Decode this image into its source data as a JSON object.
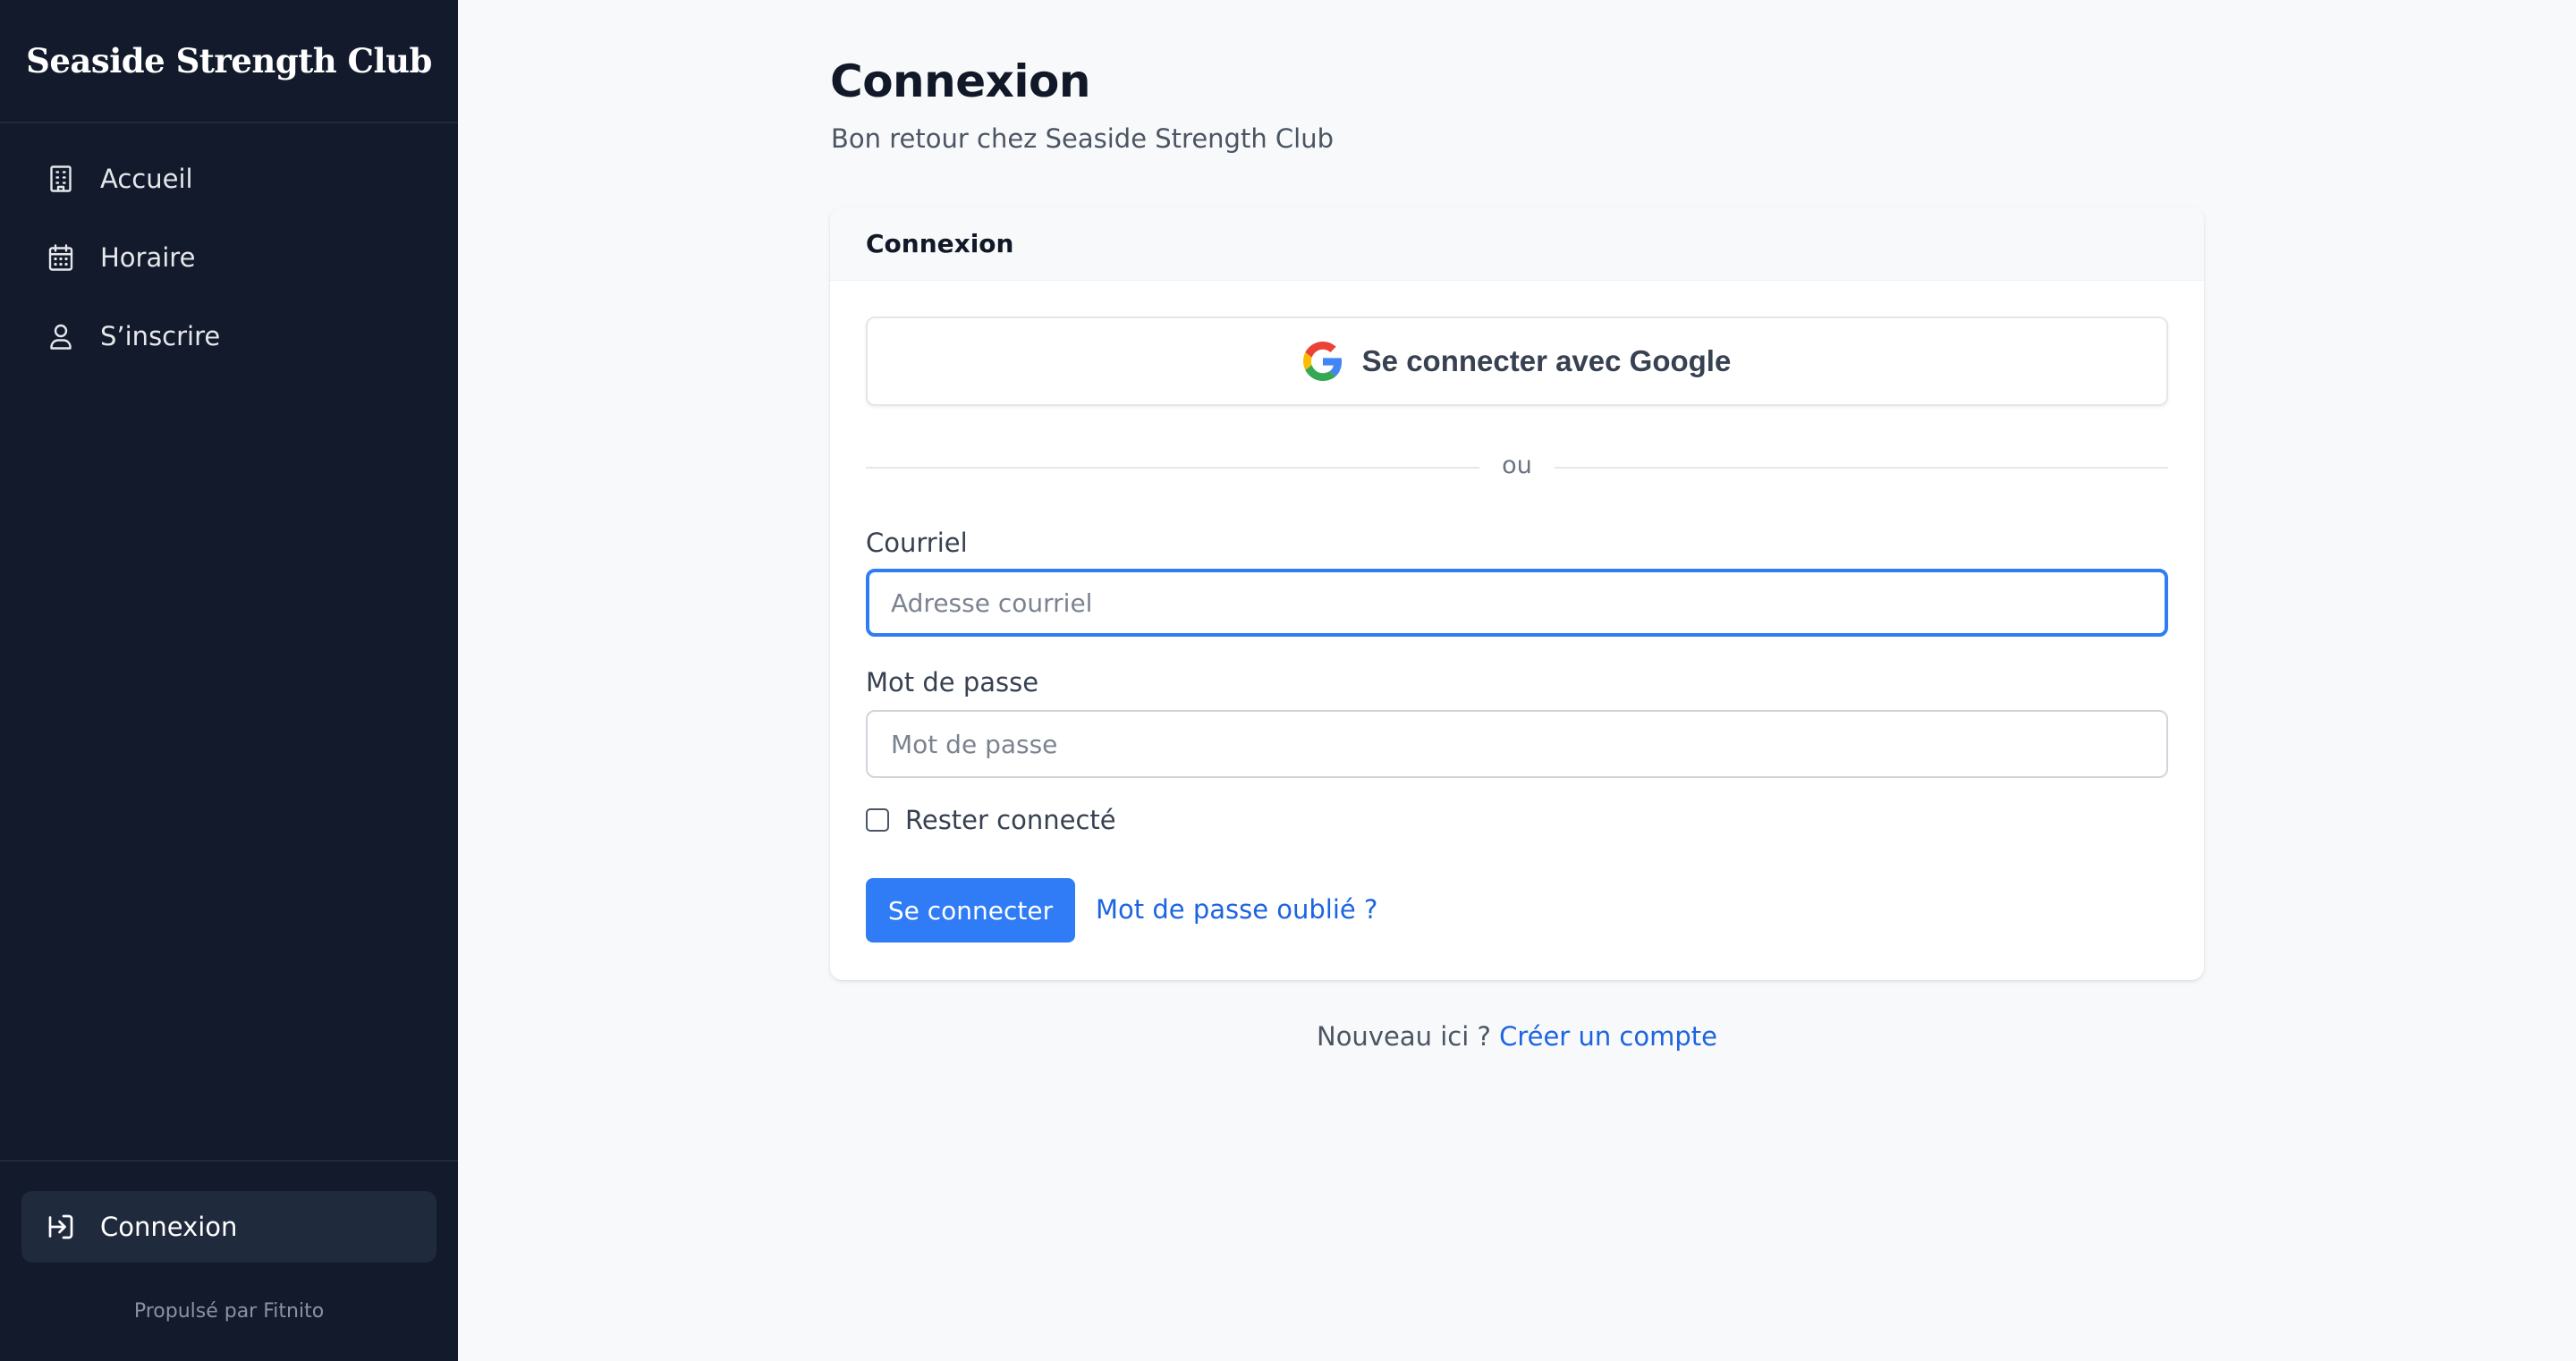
{
  "sidebar": {
    "brand": "Seaside Strength Club",
    "items": [
      {
        "label": "Accueil",
        "icon": "building-icon"
      },
      {
        "label": "Horaire",
        "icon": "calendar-icon"
      },
      {
        "label": "S’inscrire",
        "icon": "user-icon"
      }
    ],
    "login": {
      "label": "Connexion",
      "icon": "login-icon"
    },
    "powered_by": "Propulsé par Fitnito"
  },
  "page": {
    "title": "Connexion",
    "subtitle": "Bon retour chez Seaside Strength Club"
  },
  "card": {
    "header": "Connexion",
    "google_button": "Se connecter avec Google",
    "divider_text": "ou",
    "email": {
      "label": "Courriel",
      "placeholder": "Adresse courriel",
      "value": ""
    },
    "password": {
      "label": "Mot de passe",
      "placeholder": "Mot de passe",
      "value": ""
    },
    "remember_label": "Rester connecté",
    "remember_checked": false,
    "submit_label": "Se connecter",
    "forgot_label": "Mot de passe oublié ?"
  },
  "signup": {
    "prompt": "Nouveau ici ?",
    "link": "Créer un compte"
  },
  "colors": {
    "sidebar_bg": "#121a2b",
    "accent": "#2f7cf6",
    "link": "#1d64e0",
    "page_bg": "#f8f9fb"
  }
}
